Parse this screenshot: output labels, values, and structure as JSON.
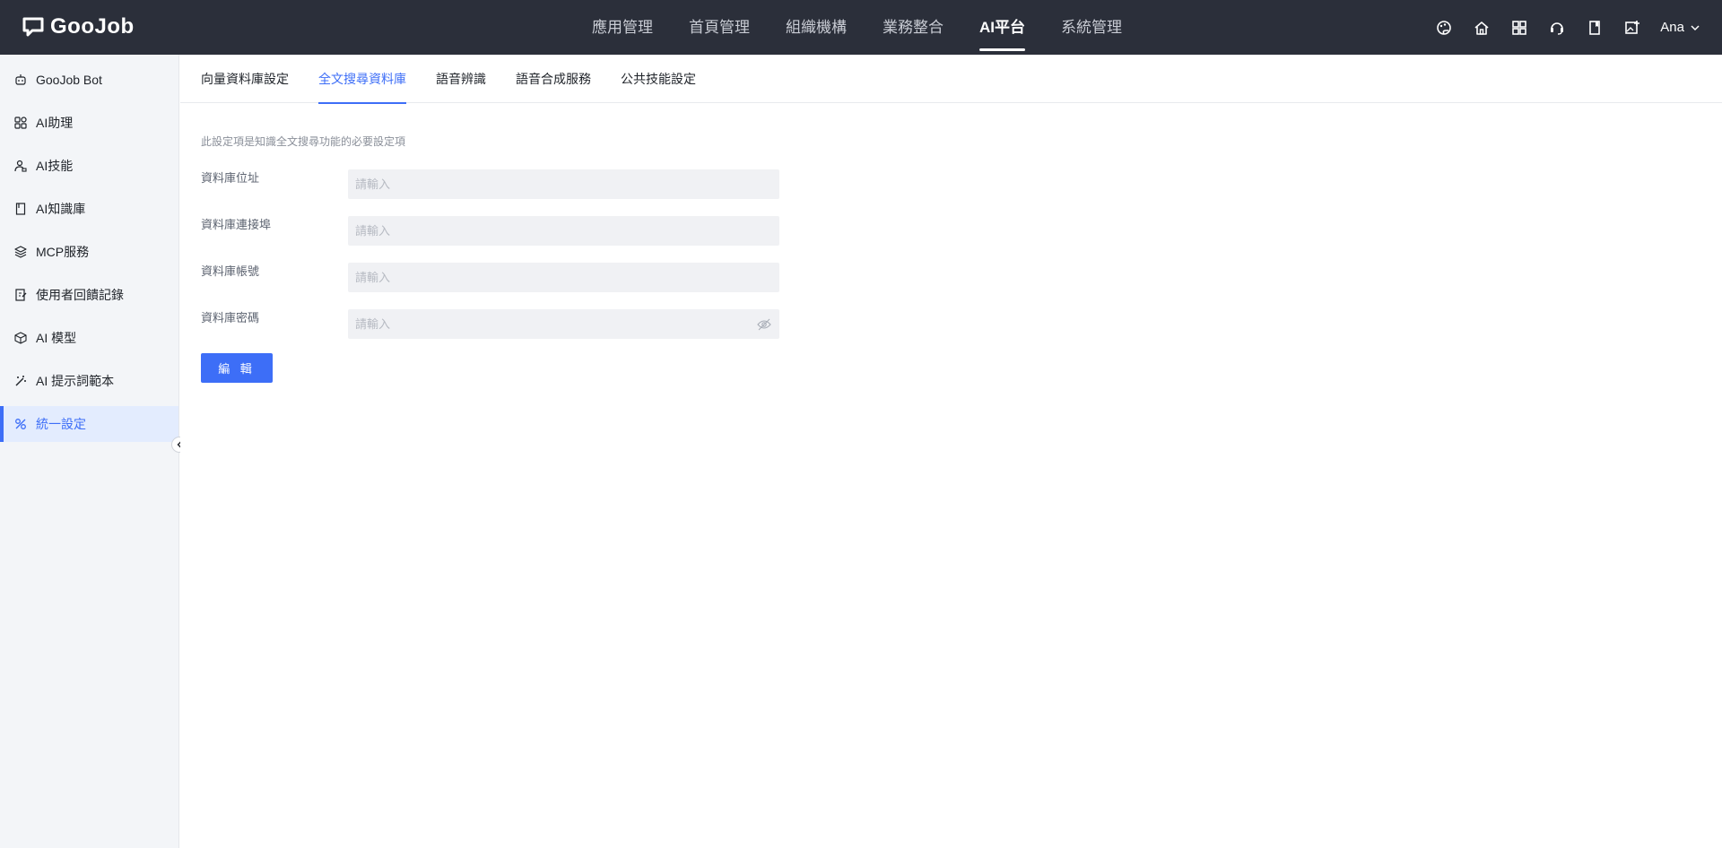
{
  "app": {
    "logo_text": "GooJob"
  },
  "topnav": {
    "items": [
      {
        "label": "應用管理"
      },
      {
        "label": "首頁管理"
      },
      {
        "label": "組織機構"
      },
      {
        "label": "業務整合"
      },
      {
        "label": "AI平台",
        "active": true
      },
      {
        "label": "系統管理"
      }
    ],
    "icons": [
      "palette-icon",
      "home-icon",
      "apps-grid-icon",
      "headset-icon",
      "book-icon",
      "image-add-icon"
    ],
    "user": {
      "name": "Ana"
    }
  },
  "sidebar": {
    "items": [
      {
        "label": "GooJob Bot",
        "icon": "bot-icon"
      },
      {
        "label": "AI助理",
        "icon": "grid-icon"
      },
      {
        "label": "AI技能",
        "icon": "skill-icon"
      },
      {
        "label": "AI知識庫",
        "icon": "book-icon"
      },
      {
        "label": "MCP服務",
        "icon": "layers-icon"
      },
      {
        "label": "使用者回饋記錄",
        "icon": "feedback-icon"
      },
      {
        "label": "AI 模型",
        "icon": "cube-icon"
      },
      {
        "label": "AI 提示詞範本",
        "icon": "magic-icon"
      },
      {
        "label": "統一設定",
        "icon": "settings-icon",
        "active": true
      }
    ]
  },
  "tabs": [
    {
      "label": "向量資料庫設定"
    },
    {
      "label": "全文搜尋資料庫",
      "active": true
    },
    {
      "label": "語音辨識"
    },
    {
      "label": "語音合成服務"
    },
    {
      "label": "公共技能設定"
    }
  ],
  "form": {
    "description": "此設定項是知識全文搜尋功能的必要設定項",
    "fields": [
      {
        "label": "資料庫位址",
        "value": "",
        "placeholder": "請輸入"
      },
      {
        "label": "資料庫連接埠",
        "value": "",
        "placeholder": "請輸入"
      },
      {
        "label": "資料庫帳號",
        "value": "",
        "placeholder": "請輸入"
      },
      {
        "label": "資料庫密碼",
        "value": "",
        "placeholder": "請輸入"
      }
    ],
    "edit_button": "編 輯"
  },
  "colors": {
    "topbar": "#2b2f3a",
    "accent": "#3d6ef7",
    "sidebar_bg": "#f3f5f8"
  }
}
